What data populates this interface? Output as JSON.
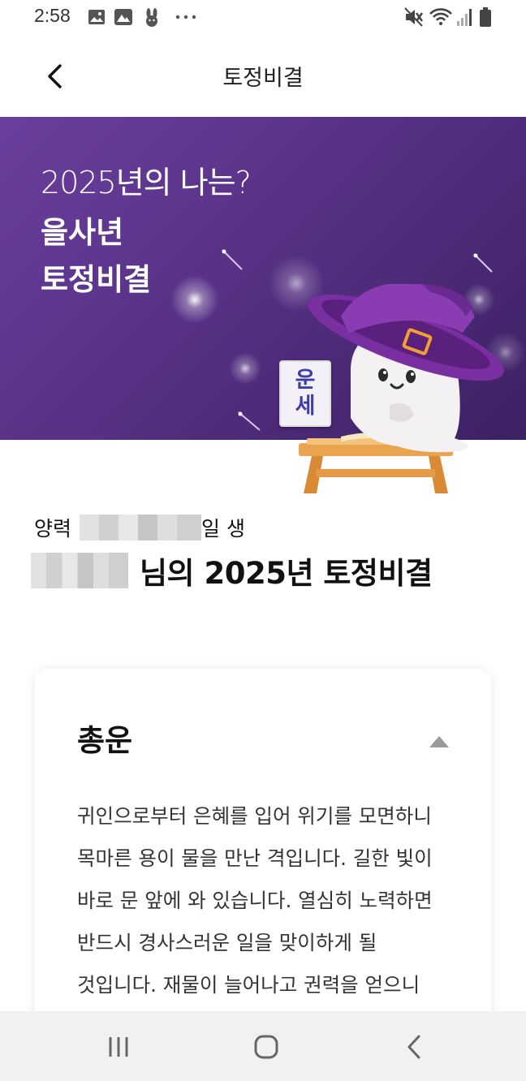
{
  "status_bar": {
    "time": "2:58",
    "left_icons": [
      "image-icon",
      "photo-icon",
      "rabbit-icon",
      "more-icon"
    ],
    "right_icons": [
      "mute-icon",
      "wifi-icon",
      "signal-icon",
      "battery-icon"
    ]
  },
  "app_bar": {
    "title": "토정비결",
    "back_icon": "chevron-left-icon"
  },
  "banner": {
    "line1": "2025년의 나는?",
    "line2": "을사년",
    "line3": "토정비결",
    "sign_char1": "운",
    "sign_char2": "세",
    "colors": {
      "bg_start": "#6a3f9e",
      "bg_end": "#3c2163",
      "hat": "#7a2fa0"
    }
  },
  "profile": {
    "birth_prefix": "양력",
    "birth_suffix": "일 생",
    "title_suffix": "님의 2025년 토정비결"
  },
  "card": {
    "title": "총운",
    "toggle_icon": "caret-up-icon",
    "body": "귀인으로부터 은혜를 입어 위기를 모면하니 목마른 용이 물을 만난 격입니다. 길한 빛이 바로 문 앞에 와 있습니다. 열심히 노력하면 반드시 경사스러운 일을 맞이하게 될 것입니다. 재물이 늘어나고 권력을 얻으니 부족함이 없습니다. 앞뒤로 나를 도와주"
  },
  "nav_bar": {
    "icons": [
      "recent-apps-icon",
      "home-icon",
      "back-icon"
    ]
  }
}
